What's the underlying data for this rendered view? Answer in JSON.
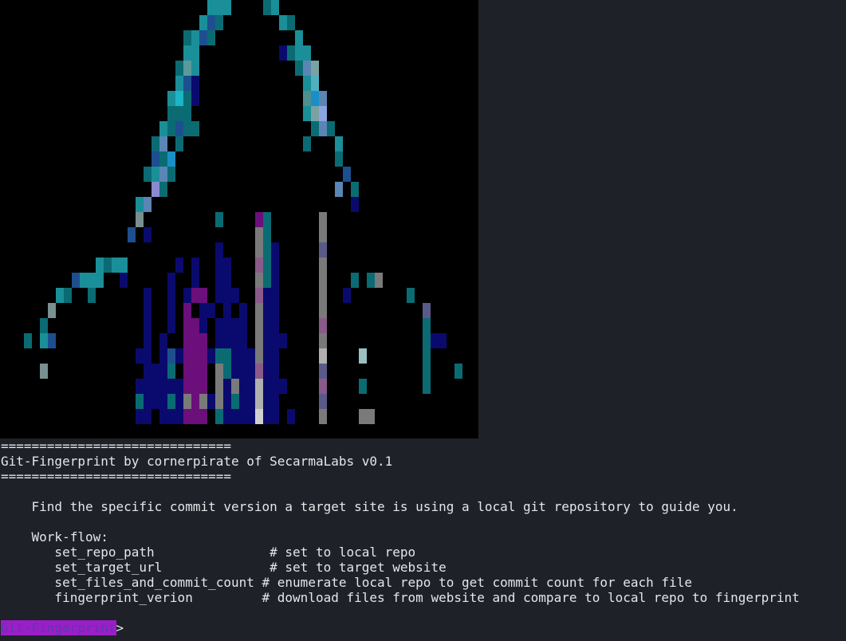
{
  "banner": {
    "divider": "==============================",
    "title": "Git-Fingerprint by cornerpirate of SecarmaLabs v0.1"
  },
  "description": "    Find the specific commit version a target site is using a local git repository to guide you.",
  "workflow": {
    "heading": "    Work-flow:",
    "steps": [
      {
        "command": "       set_repo_path               # set to local repo"
      },
      {
        "command": "       set_target_url              # set to target website"
      },
      {
        "command": "       set_files_and_commit_count # enumerate local repo to get commit count for each file"
      },
      {
        "command": "       fingerprint_verion         # download files from website and compare to local repo to fingerprint"
      }
    ]
  },
  "prompt": {
    "label": "Git-Fingerprint",
    "symbol": ">"
  },
  "colors": {
    "background": "#1e2228",
    "art_background": "#000000",
    "teal": "#0b6b73",
    "cyan": "#1a8f99",
    "navy": "#0a0a6e",
    "purple": "#6b0f7a",
    "gray": "#7a7a7a",
    "prompt_highlight": "#9c1ec9"
  }
}
